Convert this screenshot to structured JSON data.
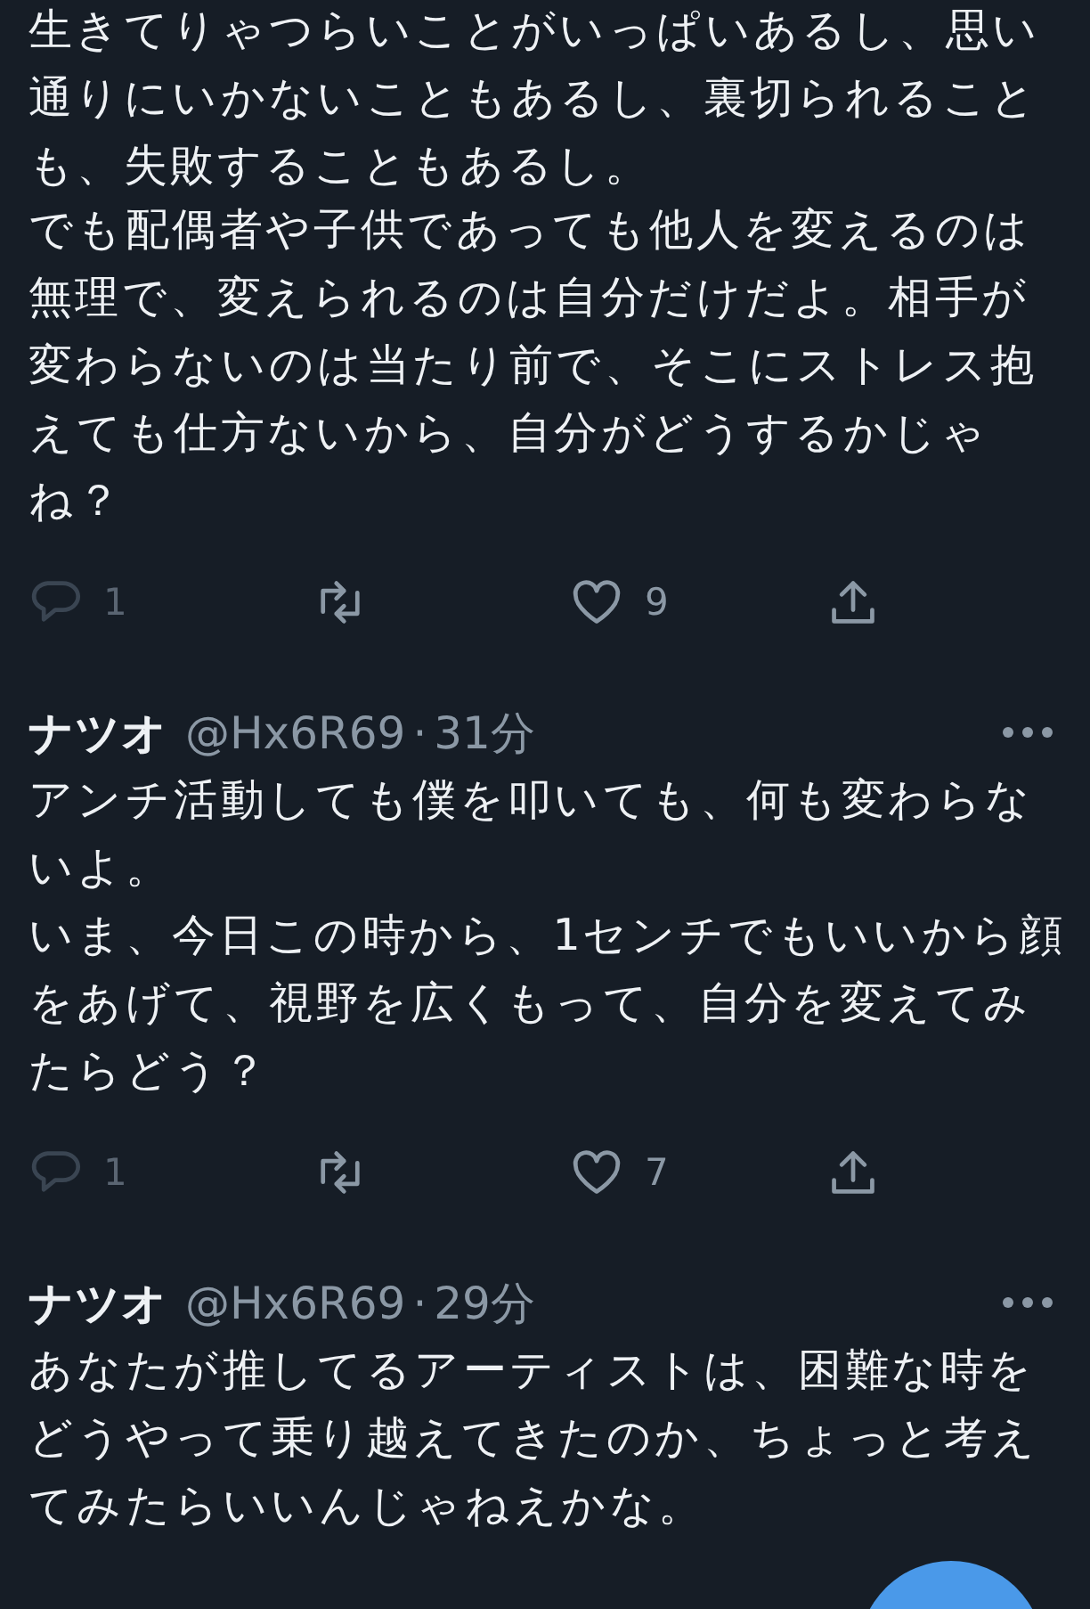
{
  "tweets": [
    {
      "paragraphs": [
        "生きてりゃつらいことがいっぱいあるし、思い通りにいかないこともあるし、裏切られることも、失敗することもあるし。",
        "でも配偶者や子供であっても他人を変えるのは無理で、変えられるのは自分だけだよ。相手が変わらないのは当たり前で、そこにストレス抱えても仕方ないから、自分がどうするかじゃね？"
      ],
      "actions": [
        {
          "kind": "reply",
          "count": "1",
          "dimmed": true
        },
        {
          "kind": "retweet"
        },
        {
          "kind": "like",
          "count": "9"
        },
        {
          "kind": "share"
        }
      ]
    },
    {
      "name": "ナツオ",
      "handle": "@Hx6R69",
      "separator": "·",
      "time": "31分",
      "paragraphs": [
        "アンチ活動しても僕を叩いても、何も変わらないよ。",
        "いま、今日この時から、1センチでもいいから顔をあげて、視野を広くもって、自分を変えてみたらどう？"
      ],
      "actions": [
        {
          "kind": "reply",
          "count": "1",
          "dimmed": true
        },
        {
          "kind": "retweet"
        },
        {
          "kind": "like",
          "count": "7"
        },
        {
          "kind": "share"
        }
      ]
    },
    {
      "name": "ナツオ",
      "handle": "@Hx6R69",
      "separator": "·",
      "time": "29分",
      "paragraphs": [
        "あなたが推してるアーティストは、困難な時をどうやって乗り越えてきたのか、ちょっと考えてみたらいいんじゃねえかな。"
      ]
    }
  ],
  "fab": {
    "kind": "compose"
  }
}
